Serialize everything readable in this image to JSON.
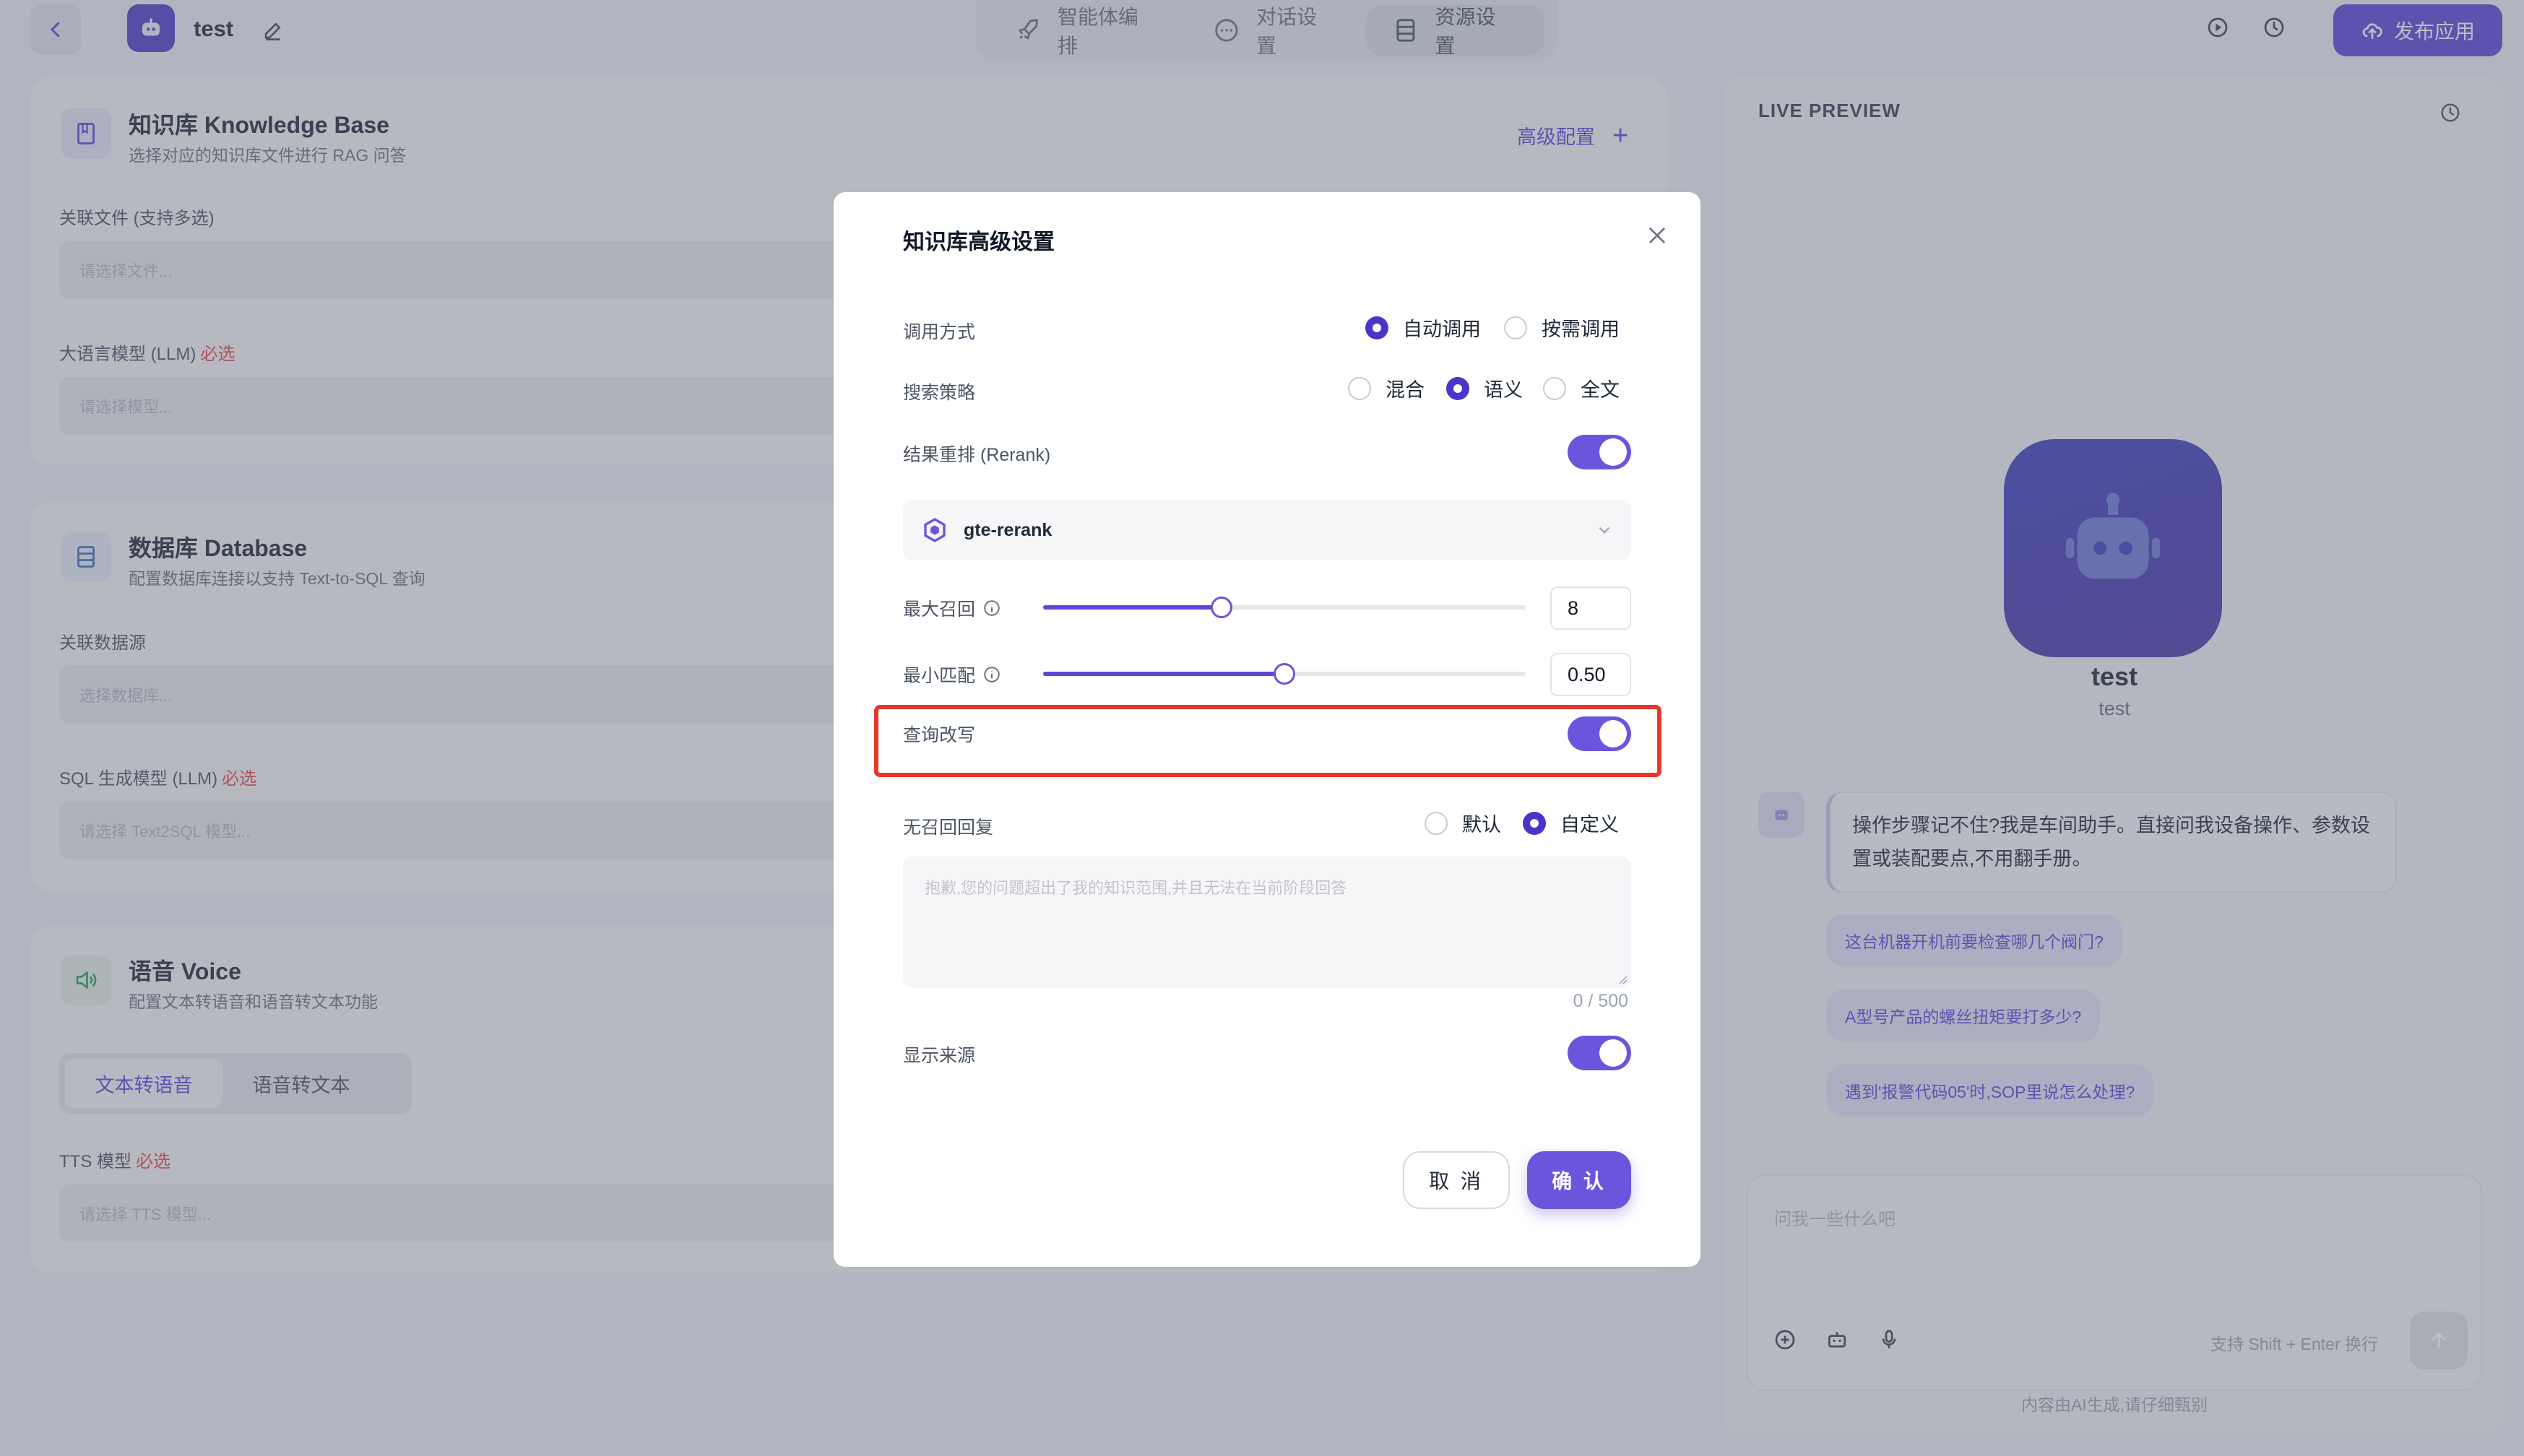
{
  "topbar": {
    "app_name": "test",
    "tabs": [
      {
        "label": "智能体编排",
        "icon": "rocket-icon"
      },
      {
        "label": "对话设置",
        "icon": "chat-icon"
      },
      {
        "label": "资源设置",
        "icon": "database-icon"
      }
    ],
    "active_tab": 2,
    "publish_label": "发布应用",
    "accent": "#5b48d8"
  },
  "knowledge": {
    "title": "知识库 Knowledge Base",
    "subtitle": "选择对应的知识库文件进行 RAG 问答",
    "advanced_label": "高级配置",
    "files_label": "关联文件 (支持多选)",
    "files_placeholder": "请选择文件...",
    "llm_label": "大语言模型 (LLM)",
    "llm_required": "必选",
    "llm_placeholder": "请选择模型..."
  },
  "database": {
    "title": "数据库 Database",
    "subtitle": "配置数据库连接以支持 Text-to-SQL 查询",
    "source_label": "关联数据源",
    "source_placeholder": "选择数据库...",
    "sql_label": "SQL 生成模型 (LLM)",
    "sql_required": "必选",
    "sql_placeholder": "请选择 Text2SQL 模型..."
  },
  "voice": {
    "title": "语音 Voice",
    "subtitle": "配置文本转语音和语音转文本功能",
    "tabs": [
      "文本转语音",
      "语音转文本"
    ],
    "tts_label": "TTS 模型",
    "tts_required": "必选",
    "tts_placeholder": "请选择 TTS 模型..."
  },
  "preview": {
    "header": "LIVE PREVIEW",
    "bot_name": "test",
    "bot_desc": "test",
    "greeting": "操作步骤记不住?我是车间助手。直接问我设备操作、参数设置或装配要点,不用翻手册。",
    "suggestions": [
      "这台机器开机前要检查哪几个阀门?",
      "A型号产品的螺丝扭矩要打多少?",
      "遇到'报警代码05'时,SOP里说怎么处理?"
    ],
    "input_placeholder": "问我一些什么吧",
    "hint": "支持 Shift + Enter 换行",
    "disclaimer": "内容由AI生成,请仔细甄别"
  },
  "modal": {
    "title": "知识库高级设置",
    "invoke_label": "调用方式",
    "invoke_options": [
      "自动调用",
      "按需调用"
    ],
    "invoke_selected": 0,
    "search_label": "搜索策略",
    "search_options": [
      "混合",
      "语义",
      "全文"
    ],
    "search_selected": 1,
    "rerank_label": "结果重排 (Rerank)",
    "rerank_on": true,
    "rerank_model": "gte-rerank",
    "max_recall_label": "最大召回",
    "max_recall_value": "8",
    "max_recall_fraction": 0.37,
    "min_match_label": "最小匹配",
    "min_match_value": "0.50",
    "min_match_fraction": 0.5,
    "rewrite_label": "查询改写",
    "rewrite_on": true,
    "no_recall_label": "无召回回复",
    "no_recall_options": [
      "默认",
      "自定义"
    ],
    "no_recall_selected": 1,
    "no_recall_placeholder": "抱歉,您的问题超出了我的知识范围,并且无法在当前阶段回答",
    "char_count": "0 / 500",
    "show_source_label": "显示来源",
    "show_source_on": true,
    "cancel_label": "取 消",
    "confirm_label": "确 认",
    "highlight_color": "#e8372c"
  }
}
